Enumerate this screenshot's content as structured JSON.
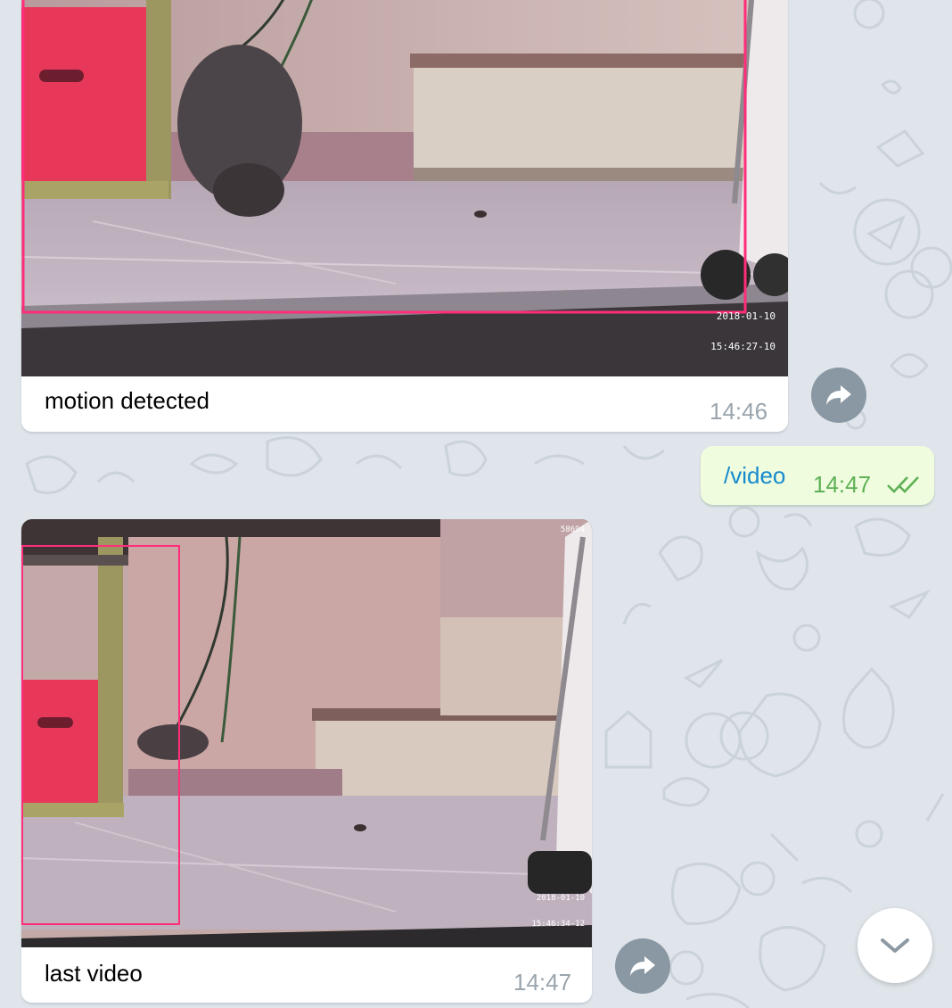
{
  "messages": [
    {
      "caption": "motion detected",
      "time": "14:46",
      "stamp_date": "2018-01-10",
      "stamp_time": "15:46:27-10"
    },
    {
      "text": "/video",
      "time": "14:47"
    },
    {
      "caption": "last video",
      "time": "14:47",
      "stamp_date": "2018-01-10",
      "stamp_time": "15:46:34-12",
      "corner_label": "58694"
    }
  ],
  "icons": {
    "share": "share-arrow-icon",
    "read": "double-check-icon",
    "scroll": "chevron-down-icon"
  },
  "colors": {
    "chat_background": "#dfe5ea",
    "outgoing_bubble": "#effdde",
    "link_blue": "#168acd",
    "read_green": "#5fb157",
    "motion_box": "#ff2d7a"
  }
}
